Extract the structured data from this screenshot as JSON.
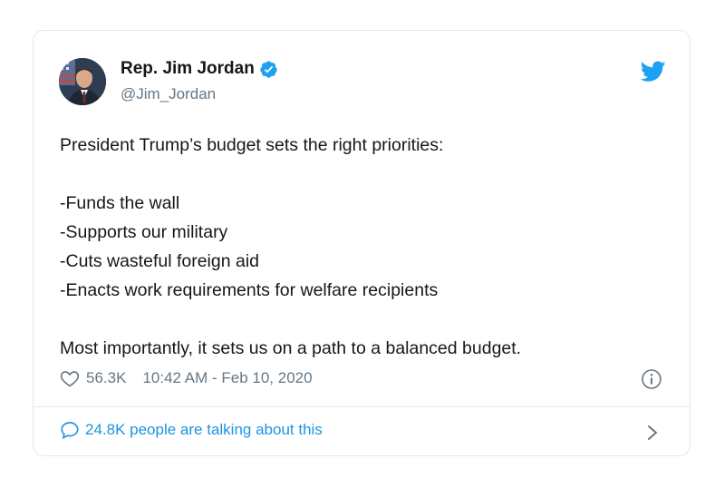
{
  "tweet": {
    "author": {
      "display_name": "Rep. Jim Jordan",
      "handle": "@Jim_Jordan",
      "verified": true,
      "avatar_icon": "profile-photo"
    },
    "text_lines": [
      "President Trump’s budget sets the right priorities:",
      "",
      "-Funds the wall",
      "-Supports our military",
      "-Cuts wasteful foreign aid",
      "-Enacts work requirements for welfare recipients",
      "",
      "Most importantly, it sets us on a path to a balanced budget."
    ],
    "likes": "56.3K",
    "timestamp": "10:42 AM - Feb 10, 2020",
    "conversation_link": "24.8K people are talking about this"
  },
  "colors": {
    "twitter_blue": "#1da1f2",
    "link_blue": "#1b95e0",
    "text_primary": "#14171a",
    "text_secondary": "#657786",
    "border": "#e1e8ed"
  },
  "icons": {
    "brand": "twitter-bird-icon",
    "verified": "verified-badge-icon",
    "like": "heart-icon",
    "info": "info-icon",
    "reply": "speech-bubble-icon",
    "more": "chevron-right-icon"
  }
}
